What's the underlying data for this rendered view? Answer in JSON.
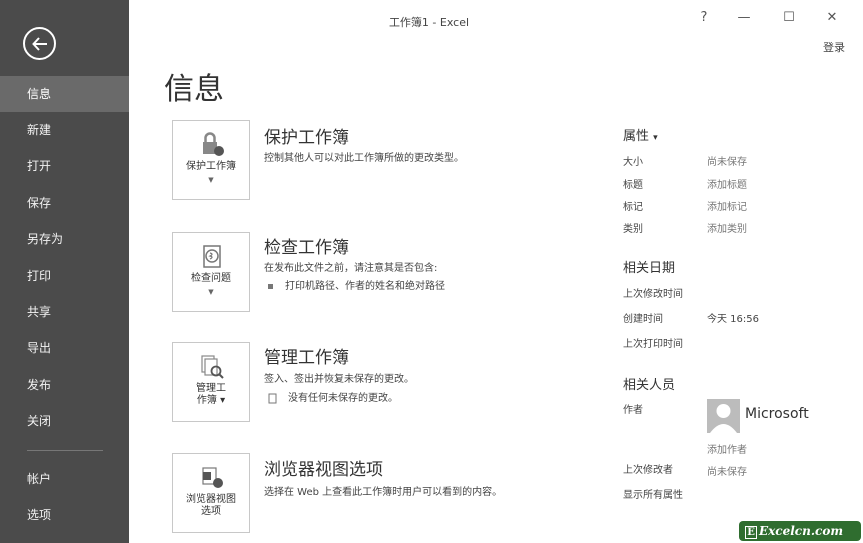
{
  "window": {
    "title": "工作簿1 - Excel",
    "help": "?",
    "minimize": "—",
    "maximize": "☐",
    "close": "✕",
    "login": "登录"
  },
  "sidebar": {
    "items": [
      {
        "label": "信息"
      },
      {
        "label": "新建"
      },
      {
        "label": "打开"
      },
      {
        "label": "保存"
      },
      {
        "label": "另存为"
      },
      {
        "label": "打印"
      },
      {
        "label": "共享"
      },
      {
        "label": "导出"
      },
      {
        "label": "发布"
      },
      {
        "label": "关闭"
      },
      {
        "label": "帐户"
      },
      {
        "label": "选项"
      }
    ]
  },
  "main": {
    "title": "信息",
    "sections": [
      {
        "tile_label": "保护工作簿",
        "heading": "保护工作簿",
        "desc": "控制其他人可以对此工作簿所做的更改类型。"
      },
      {
        "tile_label": "检查问题",
        "heading": "检查工作簿",
        "desc": "在发布此文件之前，请注意其是否包含:",
        "sub": "打印机路径、作者的姓名和绝对路径"
      },
      {
        "tile_label_1": "管理工",
        "tile_label_2": "作簿",
        "heading": "管理工作簿",
        "desc": "签入、签出并恢复未保存的更改。",
        "sub": "没有任何未保存的更改。"
      },
      {
        "tile_label_1": "浏览器视图",
        "tile_label_2": "选项",
        "heading": "浏览器视图选项",
        "desc": "选择在 Web 上查看此工作簿时用户可以看到的内容。"
      }
    ]
  },
  "properties": {
    "heading": "属性",
    "size_label": "大小",
    "size_value": "尚未保存",
    "title_label": "标题",
    "title_value": "添加标题",
    "tags_label": "标记",
    "tags_value": "添加标记",
    "category_label": "类别",
    "category_value": "添加类别",
    "dates_heading": "相关日期",
    "modified_label": "上次修改时间",
    "created_label": "创建时间",
    "created_value": "今天 16:56",
    "printed_label": "上次打印时间",
    "people_heading": "相关人员",
    "author_label": "作者",
    "author_name": "Microsoft",
    "add_author": "添加作者",
    "last_modified_by_label": "上次修改者",
    "last_modified_by_value": "尚未保存",
    "show_all": "显示所有属性"
  },
  "watermark": {
    "letter": "E",
    "text": "Excelcn.com"
  }
}
